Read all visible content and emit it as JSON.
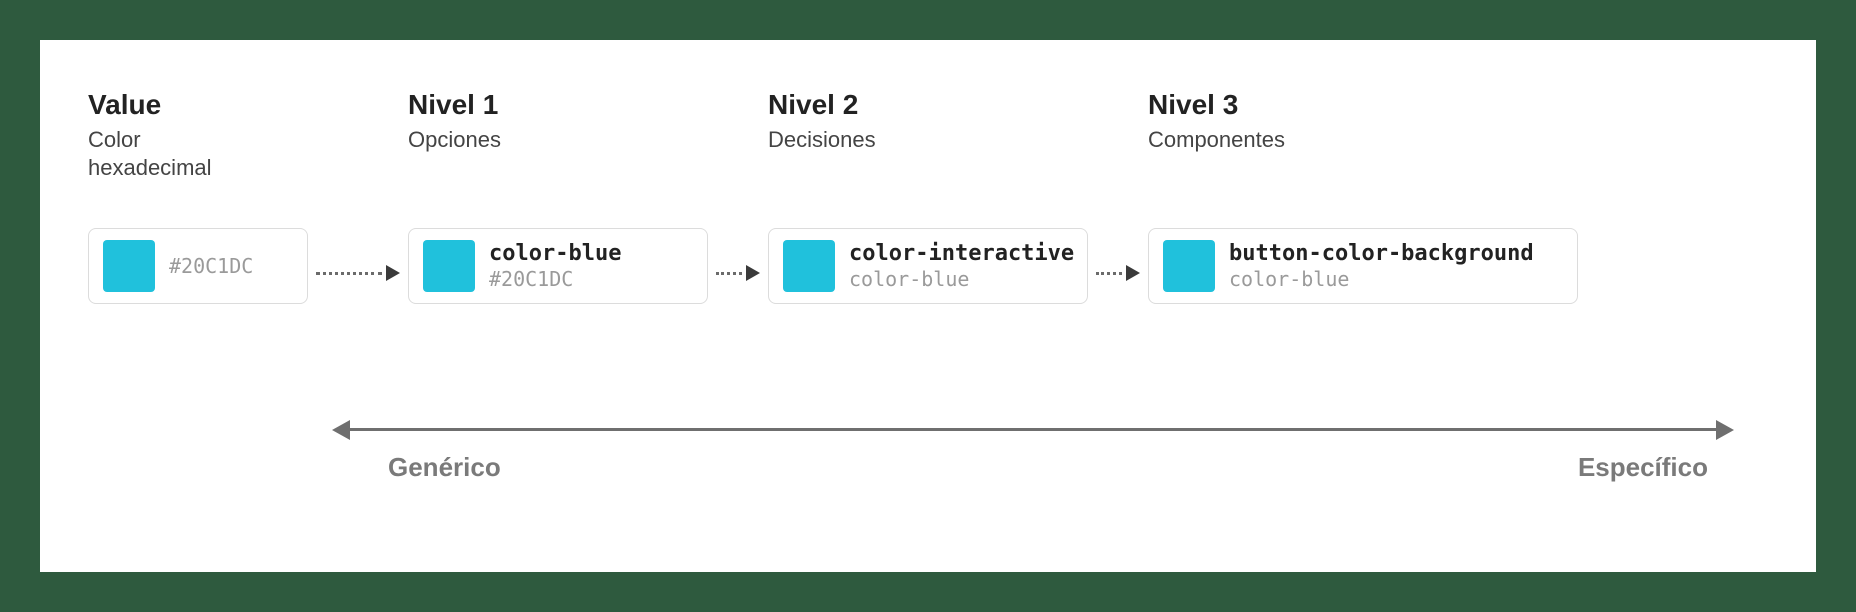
{
  "swatch_color": "#20C1DC",
  "columns": {
    "value": {
      "title": "Value",
      "subtitle": "Color hexadecimal"
    },
    "level1": {
      "title": "Nivel 1",
      "subtitle": "Opciones"
    },
    "level2": {
      "title": "Nivel 2",
      "subtitle": "Decisiones"
    },
    "level3": {
      "title": "Nivel 3",
      "subtitle": "Componentes"
    }
  },
  "tokens": {
    "value": {
      "name": "",
      "sub": "#20C1DC"
    },
    "level1": {
      "name": "color-blue",
      "sub": "#20C1DC"
    },
    "level2": {
      "name": "color-interactive",
      "sub": "color-blue"
    },
    "level3": {
      "name": "button-color-background",
      "sub": "color-blue"
    }
  },
  "axis": {
    "left": "Genérico",
    "right": "Específico"
  }
}
